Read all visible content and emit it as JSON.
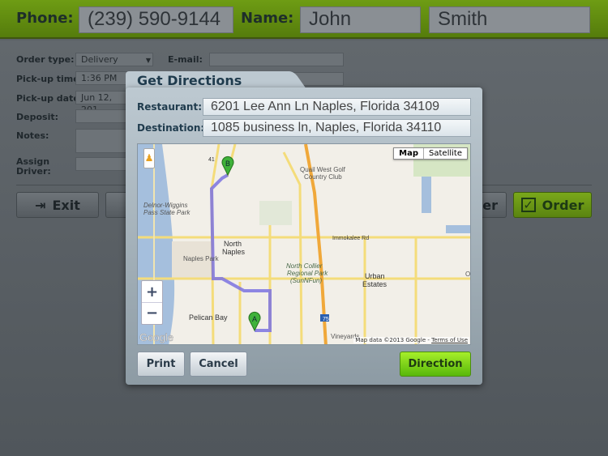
{
  "header": {
    "phone_label": "Phone:",
    "phone": "(239) 590-9144",
    "name_label": "Name:",
    "first_name": "John",
    "last_name": "Smith"
  },
  "form": {
    "order_type_label": "Order type:",
    "order_type": "Delivery",
    "email_label": "E-mail:",
    "pickup_time_label": "Pick-up time:",
    "pickup_time": "1:36 PM",
    "pickup_date_label": "Pick-up date:",
    "pickup_date": "Jun 12, 201",
    "deposit_label": "Deposit:",
    "notes_label": "Notes:",
    "assign_driver_label": "Assign Driver:"
  },
  "buttons": {
    "exit": "Exit",
    "partial": "der",
    "order": "Order"
  },
  "dialog": {
    "title": "Get Directions",
    "restaurant_label": "Restaurant:",
    "restaurant": "6201 Lee Ann Ln Naples, Florida 34109",
    "destination_label": "Destination:",
    "destination": "1085 business ln, Naples, Florida 34110",
    "print": "Print",
    "cancel": "Cancel",
    "direction": "Direction"
  },
  "map": {
    "type_map": "Map",
    "type_satellite": "Satellite",
    "zoom_in": "+",
    "zoom_out": "−",
    "logo": "Google",
    "attribution": "Map data ©2013 Google - ",
    "terms": "Terms of Use",
    "marker_a": "A",
    "marker_b": "B",
    "labels": {
      "quail": "Quail West Golf",
      "quail2": "Country Club",
      "delnor": "Delnor-Wiggins",
      "delnor2": "Pass State Park",
      "north": "North",
      "naples": "Naples",
      "naples_park": "Naples Park",
      "ncollier": "North Collier",
      "ncollier2": "Regional Park",
      "ncollier3": "(SunNFun)",
      "urban": "Urban",
      "estates": "Estates",
      "pelican": "Pelican Bay",
      "vineyards": "Vineyards",
      "immokalee": "Immokalee Rd",
      "us41": "41",
      "i75": "75",
      "ol": "Ol"
    }
  },
  "colors": {
    "header_green": "#6e9c14",
    "direction_green": "#7fd51a",
    "route": "#7b72e0",
    "marker": "#3fb23a"
  }
}
